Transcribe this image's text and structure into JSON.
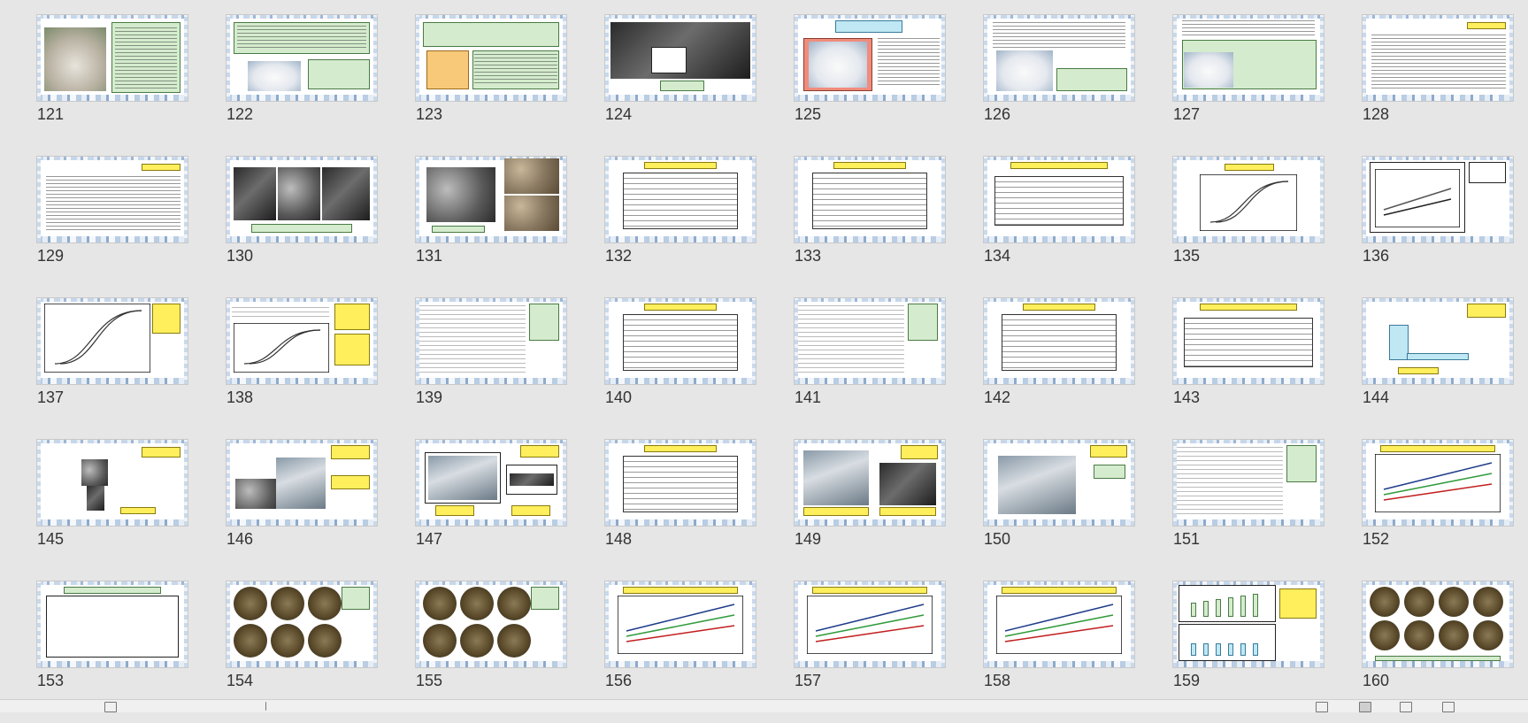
{
  "view": "slide-sorter",
  "slides": [
    {
      "number": "121",
      "layout": "photo-left-text"
    },
    {
      "number": "122",
      "layout": "text-powder"
    },
    {
      "number": "123",
      "layout": "text-colored"
    },
    {
      "number": "124",
      "layout": "micro-photo"
    },
    {
      "number": "125",
      "layout": "powder-pink"
    },
    {
      "number": "126",
      "layout": "powder-text"
    },
    {
      "number": "127",
      "layout": "powder-text2"
    },
    {
      "number": "128",
      "layout": "text-only"
    },
    {
      "number": "129",
      "layout": "text-only"
    },
    {
      "number": "130",
      "layout": "three-photos"
    },
    {
      "number": "131",
      "layout": "photos-grid"
    },
    {
      "number": "132",
      "layout": "table"
    },
    {
      "number": "133",
      "layout": "table"
    },
    {
      "number": "134",
      "layout": "table-small"
    },
    {
      "number": "135",
      "layout": "curve"
    },
    {
      "number": "136",
      "layout": "chart-side"
    },
    {
      "number": "137",
      "layout": "curve-side"
    },
    {
      "number": "138",
      "layout": "curve-side2"
    },
    {
      "number": "139",
      "layout": "wide-table"
    },
    {
      "number": "140",
      "layout": "table"
    },
    {
      "number": "141",
      "layout": "wide-table"
    },
    {
      "number": "142",
      "layout": "table"
    },
    {
      "number": "143",
      "layout": "table-small"
    },
    {
      "number": "144",
      "layout": "apparatus"
    },
    {
      "number": "145",
      "layout": "funnel"
    },
    {
      "number": "146",
      "layout": "bucket"
    },
    {
      "number": "147",
      "layout": "equipment"
    },
    {
      "number": "148",
      "layout": "table"
    },
    {
      "number": "149",
      "layout": "two-photos"
    },
    {
      "number": "150",
      "layout": "lab-photo"
    },
    {
      "number": "151",
      "layout": "wide-table"
    },
    {
      "number": "152",
      "layout": "line-chart"
    },
    {
      "number": "153",
      "layout": "sketch"
    },
    {
      "number": "154",
      "layout": "bronze-grid"
    },
    {
      "number": "155",
      "layout": "bronze-grid"
    },
    {
      "number": "156",
      "layout": "line-chart"
    },
    {
      "number": "157",
      "layout": "line-chart"
    },
    {
      "number": "158",
      "layout": "line-chart"
    },
    {
      "number": "159",
      "layout": "bar-charts"
    },
    {
      "number": "160",
      "layout": "bronze-grid8"
    }
  ]
}
